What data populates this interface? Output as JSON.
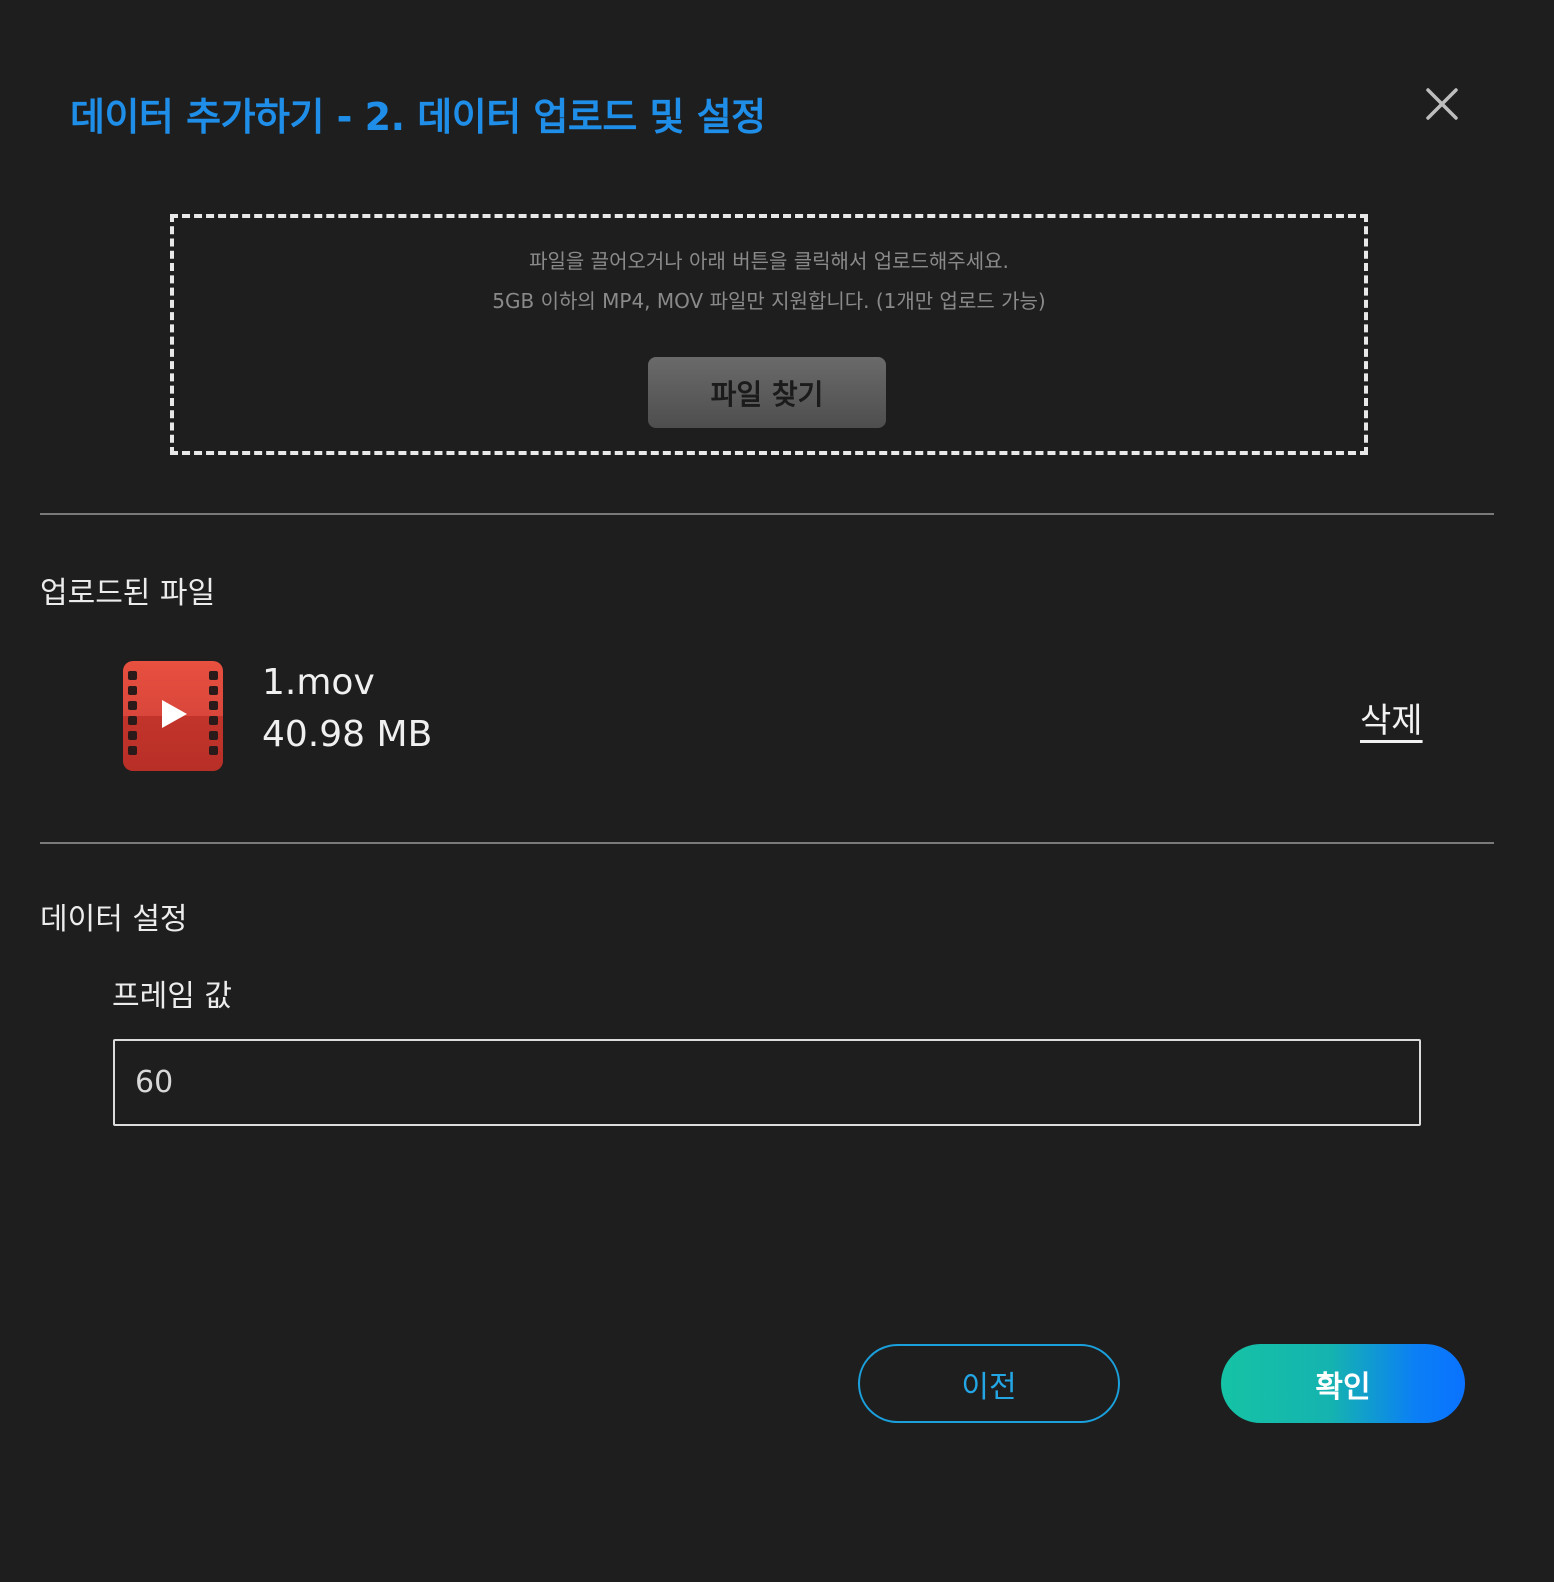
{
  "dialog": {
    "title": "데이터 추가하기 - 2. 데이터 업로드 및 설정",
    "close_icon": "close-icon"
  },
  "dropzone": {
    "line1": "파일을 끌어오거나 아래 버튼을 클릭해서 업로드해주세요.",
    "line2": "5GB 이하의 MP4, MOV 파일만 지원합니다. (1개만 업로드 가능)",
    "find_button_label": "파일 찾기"
  },
  "uploaded": {
    "section_title": "업로드된 파일",
    "file": {
      "icon": "video-file-icon",
      "name": "1.mov",
      "size": "40.98 MB",
      "delete_label": "삭제"
    }
  },
  "settings": {
    "section_title": "데이터 설정",
    "frame_label": "프레임 값",
    "frame_value": "60"
  },
  "footer": {
    "prev_label": "이전",
    "ok_label": "확인"
  },
  "colors": {
    "title": "#1e8ee8",
    "background": "#1e1e1f",
    "prev_border": "#1aa0dc",
    "ok_gradient_start": "#15c3a5",
    "ok_gradient_end": "#0a72ff",
    "video_icon": "#d9463b"
  }
}
